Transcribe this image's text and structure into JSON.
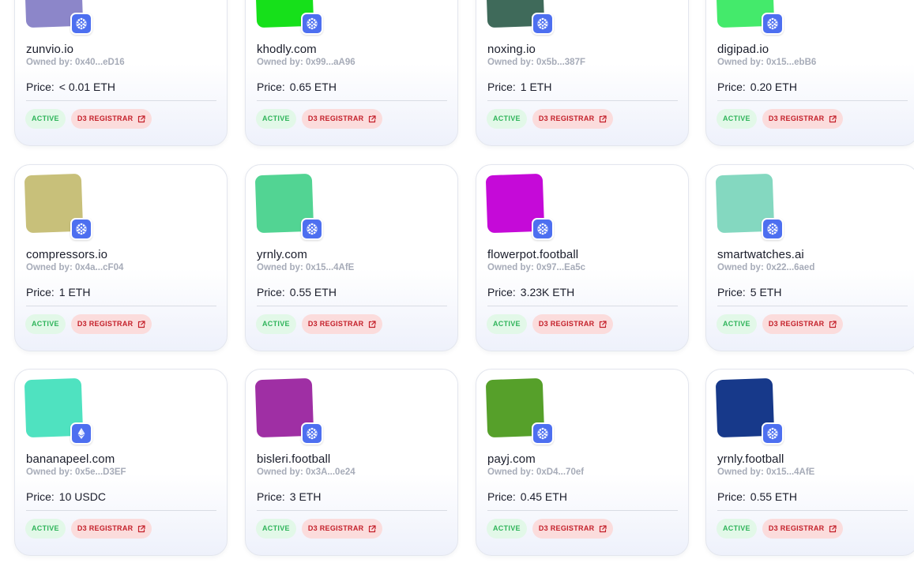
{
  "labels": {
    "price": "Price:",
    "status": "ACTIVE",
    "registrar": "D3 REGISTRAR"
  },
  "colors": {
    "status_bg": "#e2f8e8",
    "status_fg": "#2fb45a",
    "registrar_bg": "#fbdcdc",
    "registrar_fg": "#c4202a",
    "chain_badge": "#4d6ff0"
  },
  "domains": [
    {
      "name": "zunvio.io",
      "owner": "Owned by: 0x40...eD16",
      "price": "< 0.01 ETH",
      "avatar_color": "#8c86c9",
      "chain_icon": "doma-chain-icon"
    },
    {
      "name": "khodly.com",
      "owner": "Owned by: 0x99...aA96",
      "price": "0.65 ETH",
      "avatar_color": "#16e01a",
      "chain_icon": "doma-chain-icon"
    },
    {
      "name": "noxing.io",
      "owner": "Owned by: 0x5b...387F",
      "price": "1 ETH",
      "avatar_color": "#3f6a5a",
      "chain_icon": "doma-chain-icon"
    },
    {
      "name": "digipad.io",
      "owner": "Owned by: 0x15...ebB6",
      "price": "0.20 ETH",
      "avatar_color": "#44ea6b",
      "chain_icon": "doma-chain-icon"
    },
    {
      "name": "compressors.io",
      "owner": "Owned by: 0x4a...cF04",
      "price": "1 ETH",
      "avatar_color": "#c8c07a",
      "chain_icon": "doma-chain-icon"
    },
    {
      "name": "yrnly.com",
      "owner": "Owned by: 0x15...4AfE",
      "price": "0.55 ETH",
      "avatar_color": "#52d493",
      "chain_icon": "doma-chain-icon"
    },
    {
      "name": "flowerpot.football",
      "owner": "Owned by: 0x97...Ea5c",
      "price": "3.23K ETH",
      "avatar_color": "#c50ad8",
      "chain_icon": "doma-chain-icon"
    },
    {
      "name": "smartwatches.ai",
      "owner": "Owned by: 0x22...6aed",
      "price": "5 ETH",
      "avatar_color": "#84d8c0",
      "chain_icon": "doma-chain-icon"
    },
    {
      "name": "bananapeel.com",
      "owner": "Owned by: 0x5e...D3EF",
      "price": "10 USDC",
      "avatar_color": "#4fe2c0",
      "chain_icon": "ethereum-icon"
    },
    {
      "name": "bisleri.football",
      "owner": "Owned by: 0x3A...0e24",
      "price": "3 ETH",
      "avatar_color": "#9f2fa4",
      "chain_icon": "doma-chain-icon"
    },
    {
      "name": "payj.com",
      "owner": "Owned by: 0xD4...70ef",
      "price": "0.45 ETH",
      "avatar_color": "#56a02a",
      "chain_icon": "doma-chain-icon"
    },
    {
      "name": "yrnly.football",
      "owner": "Owned by: 0x15...4AfE",
      "price": "0.55 ETH",
      "avatar_color": "#17398a",
      "chain_icon": "doma-chain-icon"
    }
  ]
}
